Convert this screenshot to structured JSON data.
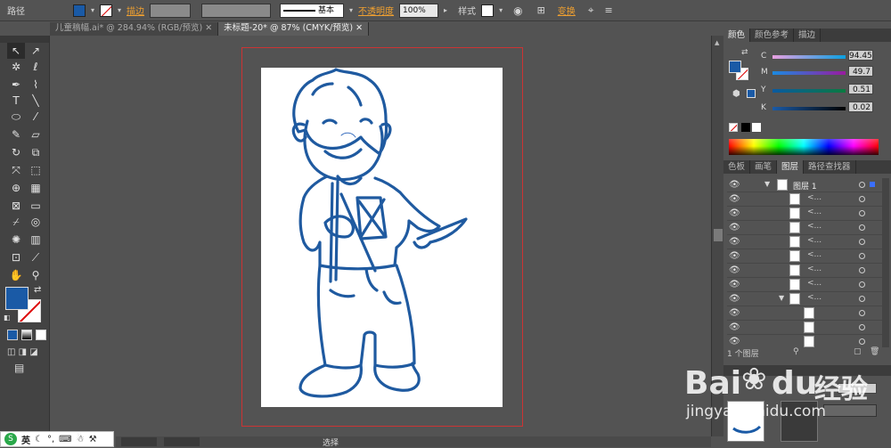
{
  "control_bar": {
    "object_type": "路径",
    "stroke_label": "描边",
    "stroke_style": "基本",
    "opacity_label": "不透明度",
    "opacity_value": "100%",
    "style_label": "样式",
    "transform_label": "变换"
  },
  "doc_tabs": [
    {
      "label": "儿童稿幅.ai* @ 284.94% (RGB/预览)",
      "active": false
    },
    {
      "label": "未标题-20* @ 87% (CMYK/预览)",
      "active": true
    }
  ],
  "color_panel": {
    "tabs": [
      "颜色",
      "颜色参考",
      "描边"
    ],
    "channels": [
      {
        "name": "C",
        "value": "94.45"
      },
      {
        "name": "M",
        "value": "49.7"
      },
      {
        "name": "Y",
        "value": "0.51"
      },
      {
        "name": "K",
        "value": "0.02"
      }
    ]
  },
  "layers_panel": {
    "tabs": [
      "色板",
      "画笔",
      "图层",
      "路径查找器"
    ],
    "top_layer": "图层 1",
    "sublayer_label": "<...",
    "count_label": "1 个图层"
  },
  "status": {
    "tool_name": "选择"
  },
  "ime": {
    "mode": "英"
  },
  "watermark": {
    "brand_a": "Bai",
    "brand_b": "du",
    "brand_cn": "经验",
    "url": "jingyan.baidu.com"
  },
  "colors": {
    "fill": "#1a5aa6",
    "drawing_stroke": "#1f5aa0",
    "bleed": "#cc3333"
  }
}
